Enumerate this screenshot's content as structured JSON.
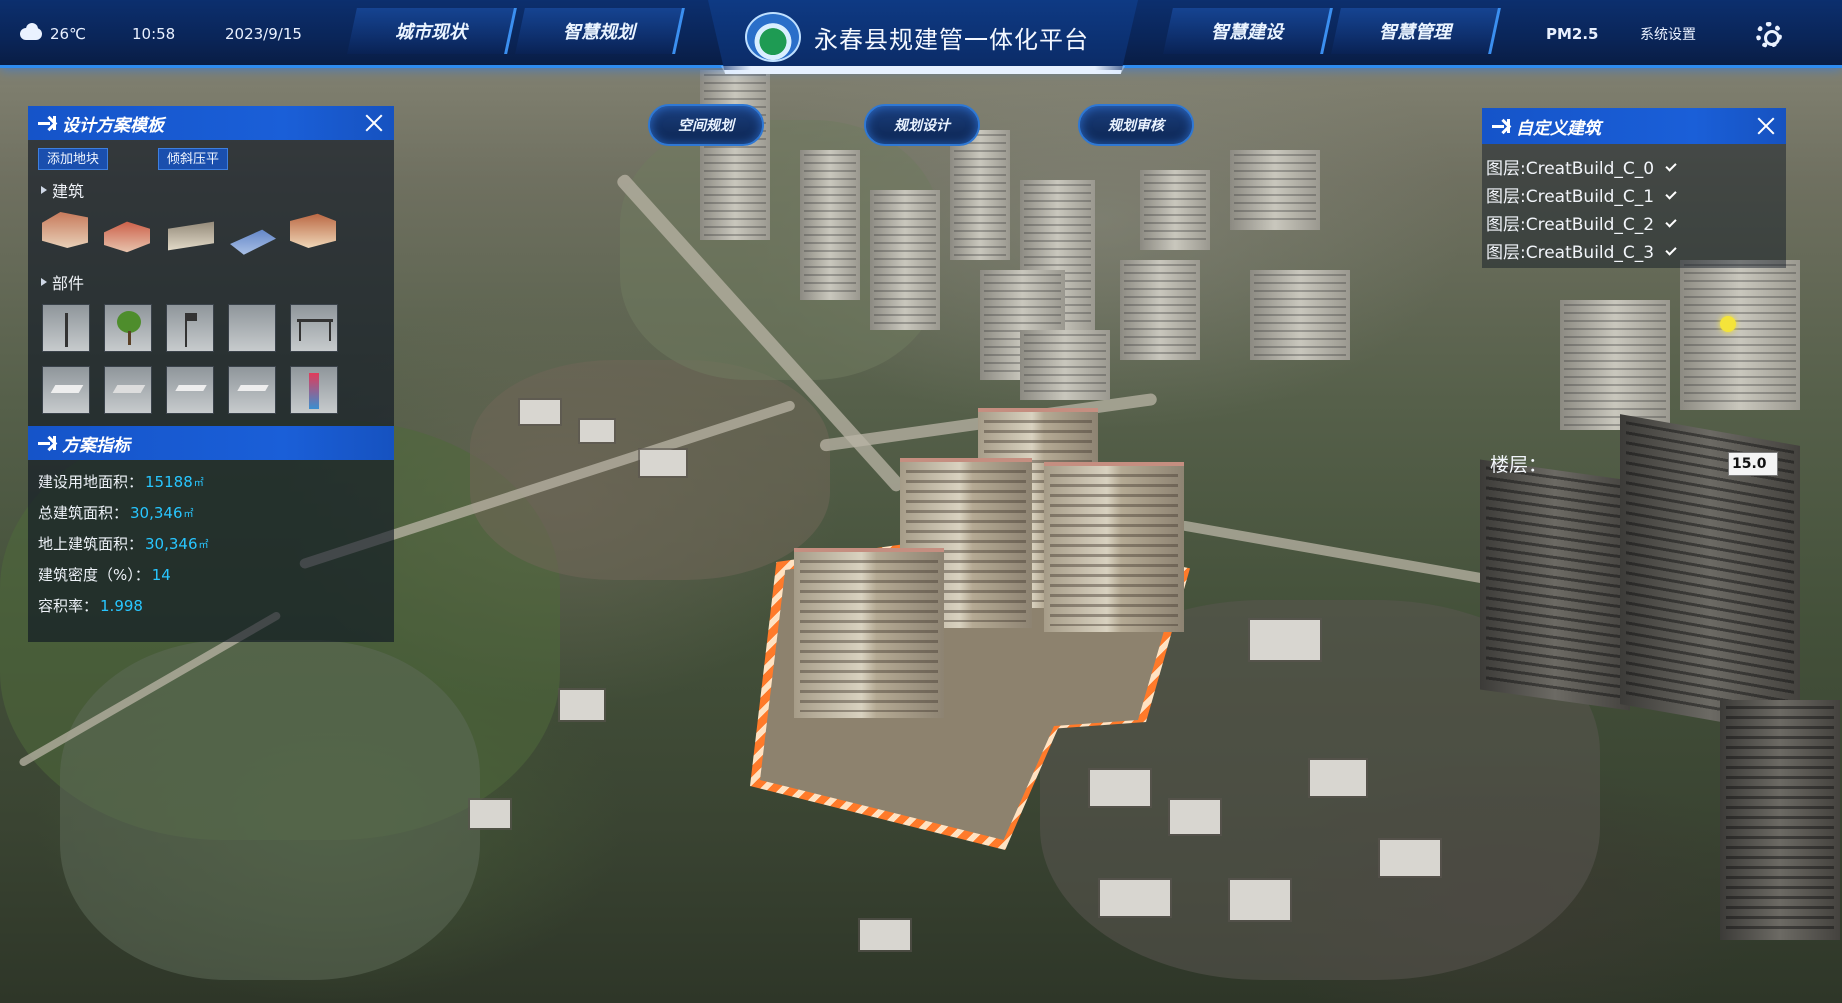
{
  "topbar": {
    "temperature": "26℃",
    "time": "10:58",
    "date": "2023/9/15",
    "nav_left": [
      "城市现状",
      "智慧规划"
    ],
    "title": "永春县规建管一体化平台",
    "nav_right": [
      "智慧建设",
      "智慧管理"
    ],
    "pm25": "PM2.5",
    "settings": "系统设置",
    "icons": {
      "weather": "cloud-sun-icon",
      "settings": "gear-icon",
      "logo": "emblem-logo"
    }
  },
  "mode_buttons": [
    "空间规划",
    "规划设计",
    "规划审核"
  ],
  "design_panel": {
    "title": "设计方案模板",
    "buttons": [
      "添加地块",
      "倾斜压平"
    ],
    "section_building": "建筑",
    "section_parts": "部件",
    "building_thumbs": [
      "building-thumb-1",
      "building-thumb-2",
      "building-thumb-3",
      "building-thumb-4",
      "building-thumb-5"
    ],
    "part_thumbs": [
      "streetlight-thumb",
      "tree-thumb",
      "sign-thumb",
      "blank-thumb",
      "shelter-thumb",
      "pad-thumb-1",
      "pad-thumb-2",
      "pad-thumb-3",
      "pad-thumb-4",
      "totem-thumb"
    ]
  },
  "metrics_panel": {
    "title": "方案指标",
    "rows": [
      {
        "label": "建设用地面积：",
        "value": "15188",
        "unit": "㎡"
      },
      {
        "label": "总建筑面积：",
        "value": "30,346",
        "unit": "㎡"
      },
      {
        "label": "地上建筑面积：",
        "value": "30,346",
        "unit": "㎡"
      },
      {
        "label": "建筑密度（%）：",
        "value": "14",
        "unit": ""
      },
      {
        "label": "容积率：",
        "value": "1.998",
        "unit": ""
      }
    ]
  },
  "custom_panel": {
    "title": "自定义建筑",
    "layers": [
      "图层:CreatBuild_C_0",
      "图层:CreatBuild_C_1",
      "图层:CreatBuild_C_2",
      "图层:CreatBuild_C_3"
    ]
  },
  "floor": {
    "label": "楼层：",
    "value": "15.0"
  },
  "colors": {
    "accent": "#1a5fd8",
    "metric_value": "#28c6ff",
    "highlight": "#ff7a2a"
  }
}
